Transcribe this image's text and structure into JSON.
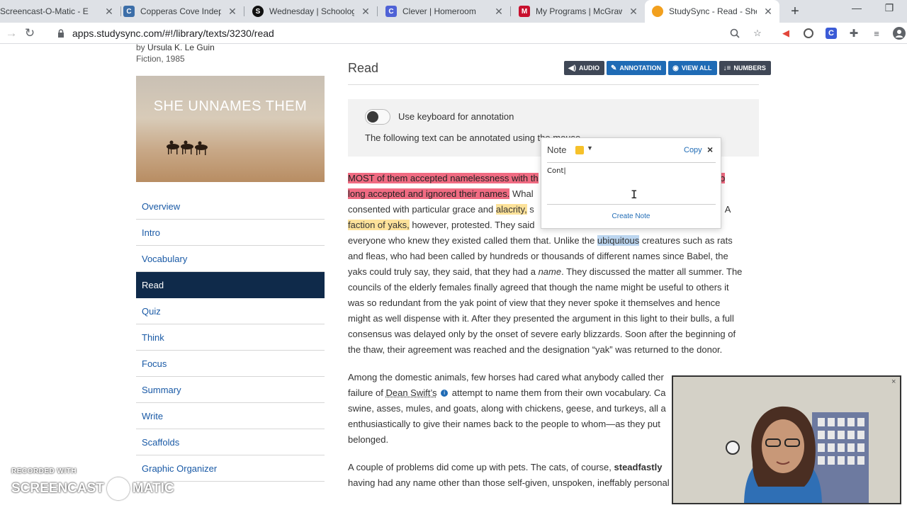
{
  "browser": {
    "tabs": [
      {
        "title": "Screencast-O-Matic - E",
        "fav_color": "#1a73e8",
        "fav_glyph": "S"
      },
      {
        "title": "Copperas Cove Indepen",
        "fav_color": "#3c6ea8",
        "fav_glyph": "C"
      },
      {
        "title": "Wednesday | Schoolog",
        "fav_color": "#111111",
        "fav_glyph": "S"
      },
      {
        "title": "Clever | Homeroom",
        "fav_color": "#4f62d6",
        "fav_glyph": "C"
      },
      {
        "title": "My Programs | McGraw",
        "fav_color": "#c8102e",
        "fav_glyph": "M"
      },
      {
        "title": "StudySync - Read - She",
        "fav_color": "#f2a01e",
        "fav_glyph": "●"
      }
    ],
    "new_tab": "+",
    "url": "apps.studysync.com/#!/library/texts/3230/read"
  },
  "book": {
    "author_prefix": "by",
    "author": "Ursula K. Le Guin",
    "meta": "Fiction, 1985",
    "cover_title": "SHE UNNAMES THEM"
  },
  "sidenav": {
    "items": [
      {
        "label": "Overview"
      },
      {
        "label": "Intro"
      },
      {
        "label": "Vocabulary"
      },
      {
        "label": "Read"
      },
      {
        "label": "Quiz"
      },
      {
        "label": "Think"
      },
      {
        "label": "Focus"
      },
      {
        "label": "Summary"
      },
      {
        "label": "Write"
      },
      {
        "label": "Scaffolds"
      },
      {
        "label": "Graphic Organizer"
      }
    ],
    "active": "Read"
  },
  "read": {
    "heading": "Read",
    "buttons": {
      "audio": "AUDIO",
      "annotation": "ANNOTATION",
      "view_all": "VIEW ALL",
      "numbers": "NUMBERS"
    },
    "toggle_label": "Use keyboard for annotation",
    "help_text": "The following text can be annotated using the mouse."
  },
  "article": {
    "p1": {
      "hl1": "MOST of them accepted namelessness with th",
      "hl1_tail": "so",
      "hl2": "long accepted and ignored their names.",
      "t1": " Whal",
      "line3_start": "consented with particular grace and ",
      "hl3": "alacrity,",
      "t2": " s",
      "t2_end": " A",
      "hl4": "faction of yaks,",
      "t3": " however, protested. They said",
      "t4": "everyone who knew they existed called them that. Unlike the ",
      "hl5": "ubiquitous",
      "t5": " creatures such as rats and fleas, who had been called by hundreds or thousands of different names since Babel, the yaks could truly say, they said, that they had a ",
      "em": "name",
      "t6": ". They discussed the matter all summer. The councils of the elderly females finally agreed that though the name might be useful to others it was so redundant from the yak point of view that they never spoke it themselves and hence might as well dispense with it. After they presented the argument in this light to their bulls, a full consensus was delayed only by the onset of severe early blizzards. Soon after the beginning of the thaw, their agreement was reached and the designation “yak” was returned to the donor."
    },
    "p2": {
      "t1": "Among the domestic animals, few horses had cared what anybody called ther",
      "t2": "failure of ",
      "link": "Dean Swift’s",
      "t3": " attempt to name them from their own vocabulary. Ca",
      "t4": "swine, asses, mules, and goats, along with chickens, geese, and turkeys, all a",
      "t5": "enthusiastically to give their names back to the people to whom—as they put",
      "t6": "belonged."
    },
    "p3": {
      "t1": "A couple of problems did come up with pets. The cats, of course, ",
      "bold": "steadfastly",
      "t2": "having had any name other than those self-given, unspoken, ineffably personal names which"
    }
  },
  "note": {
    "title": "Note",
    "color": "#f6c12a",
    "copy": "Copy",
    "close": "×",
    "text": "Cont|",
    "create": "Create Note"
  },
  "watermark": {
    "line1": "RECORDED WITH",
    "left": "SCREENCAST",
    "right": "MATIC"
  },
  "webcam": {
    "close": "×"
  }
}
